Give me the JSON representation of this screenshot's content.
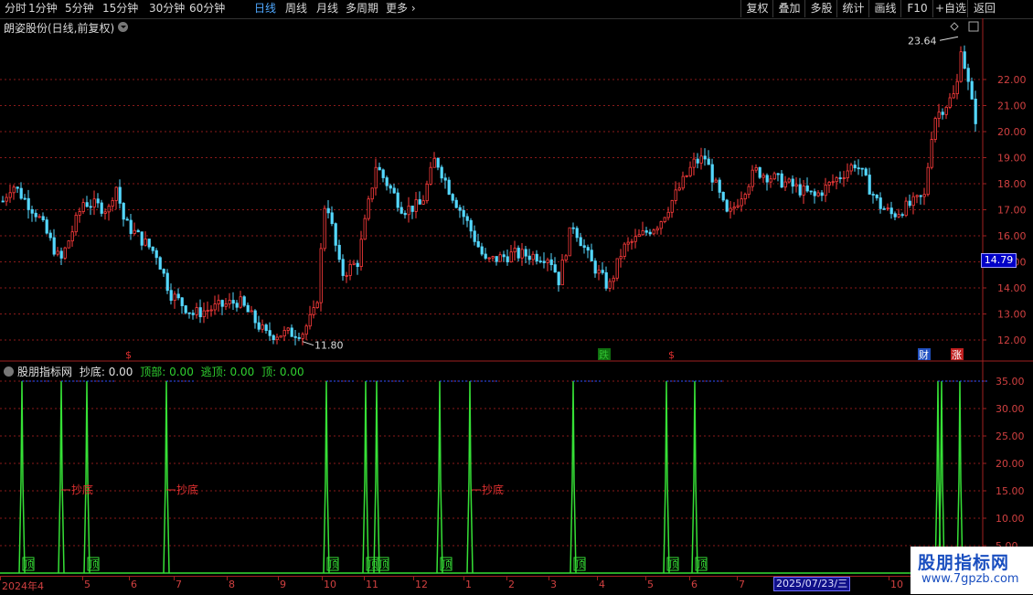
{
  "toolbar": {
    "periods": [
      "分时",
      "1分钟",
      "5分钟",
      "15分钟",
      "30分钟",
      "60分钟",
      "日线",
      "周线",
      "月线",
      "多周期",
      "更多"
    ],
    "active_period": "日线",
    "right_buttons": [
      "复权",
      "叠加",
      "多股",
      "统计",
      "画线",
      "F10",
      "+自选",
      "返回"
    ]
  },
  "stock": {
    "title": "朗姿股份(日线,前复权)"
  },
  "price_axis": {
    "labels": [
      "22.00",
      "21.00",
      "20.00",
      "19.00",
      "18.00",
      "17.00",
      "16.00",
      "15.00",
      "14.00",
      "13.00",
      "12.00"
    ],
    "current_price": "14.79",
    "high_marker": "23.64",
    "low_marker": "11.80"
  },
  "event_markers": [
    {
      "label": "$",
      "color": "#e03030"
    },
    {
      "label": "跌",
      "color": "#30c030"
    },
    {
      "label": "$",
      "color": "#e03030"
    },
    {
      "label": "财",
      "color": "#ffffff"
    },
    {
      "label": "涨",
      "color": "#ffffff"
    }
  ],
  "indicator": {
    "name": "股朋指标网",
    "fields": [
      {
        "label": "抄底: 0.00",
        "color": "#e0e0e0"
      },
      {
        "label": "顶部: 0.00",
        "color": "#30d030"
      },
      {
        "label": "逃顶: 0.00",
        "color": "#30d030"
      },
      {
        "label": "顶: 0.00",
        "color": "#30d030"
      }
    ],
    "axis_labels": [
      "35.00",
      "30.00",
      "25.00",
      "20.00",
      "15.00",
      "10.00",
      "5.00"
    ],
    "annotation_buy": "抄底",
    "annotation_top": "顶"
  },
  "x_axis": {
    "labels": [
      "2024年4",
      "5",
      "6",
      "7",
      "8",
      "9",
      "10",
      "11",
      "12",
      "1",
      "2",
      "3",
      "4",
      "5",
      "6",
      "7",
      "10"
    ],
    "cursor_date": "2025/07/23/三"
  },
  "watermark": {
    "line1": "股朋指标网",
    "line2": "www.7gpzb.com"
  },
  "colors": {
    "up": "#ff3c3c",
    "down": "#54d8ff",
    "signal": "#36e036",
    "grid": "#8a1a1a"
  }
}
